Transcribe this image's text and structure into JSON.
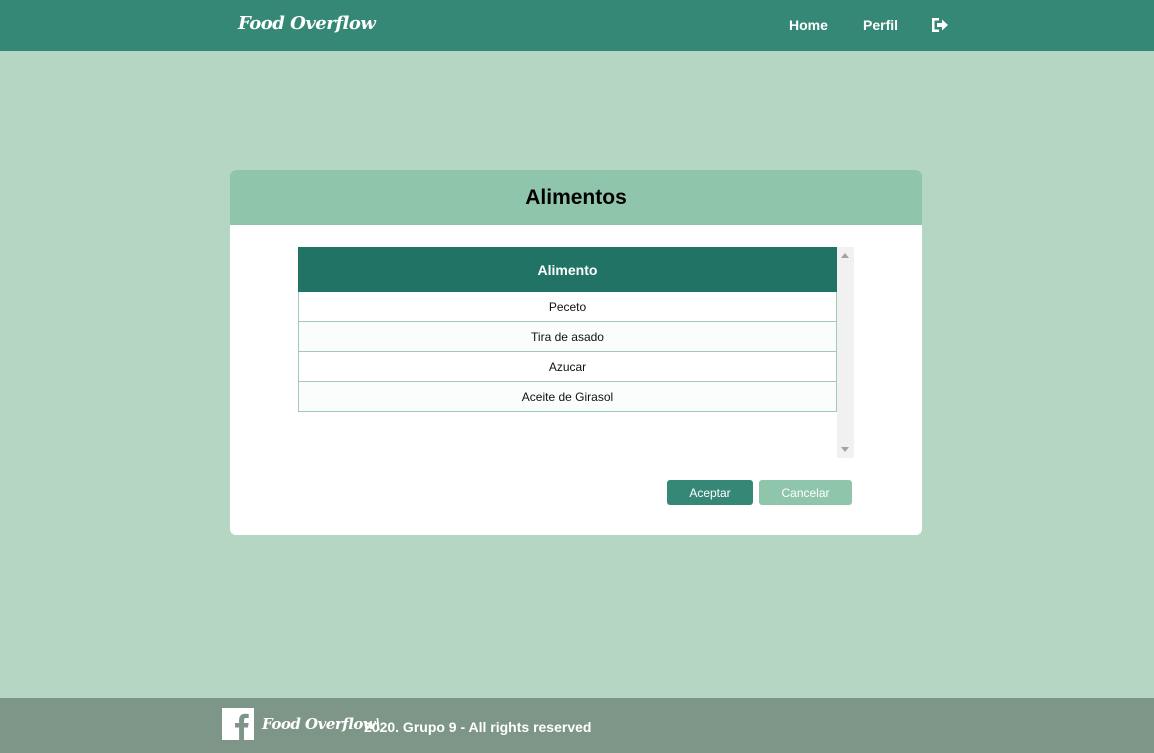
{
  "navbar": {
    "brand": "Food Overflow",
    "links": [
      "Home",
      "Perfil"
    ],
    "logout_icon": "sign-out-icon"
  },
  "card": {
    "title": "Alimentos",
    "table": {
      "header": "Alimento",
      "rows": [
        "Peceto",
        "Tira de asado",
        "Azucar",
        "Aceite de Girasol"
      ]
    },
    "buttons": {
      "accept": "Aceptar",
      "cancel": "Cancelar"
    }
  },
  "footer": {
    "icon": "facebook-icon",
    "brand": "Food Overflow\\",
    "text": "2020. Grupo 9 - All rights reserved"
  },
  "colors": {
    "page_bg": "#b4d6c2",
    "navbar": "#358876",
    "card_header": "#8fc6ab",
    "table_header": "#217366",
    "footer": "#7d9687"
  }
}
